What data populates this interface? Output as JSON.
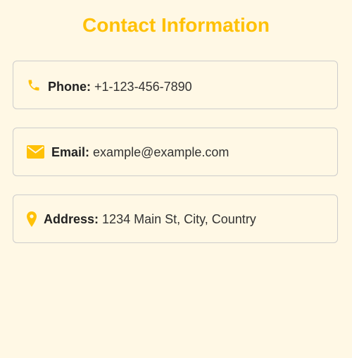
{
  "page": {
    "title": "Contact Information"
  },
  "contacts": [
    {
      "icon": "phone-icon",
      "label": "Phone:",
      "value": "+1-123-456-7890"
    },
    {
      "icon": "envelope-icon",
      "label": "Email:",
      "value": "example@example.com"
    },
    {
      "icon": "map-pin-icon",
      "label": "Address:",
      "value": "1234 Main St, City, Country"
    }
  ],
  "colors": {
    "accent": "#ffc107",
    "background": "#fff8e5",
    "border": "#cccccc",
    "text": "#333333"
  }
}
